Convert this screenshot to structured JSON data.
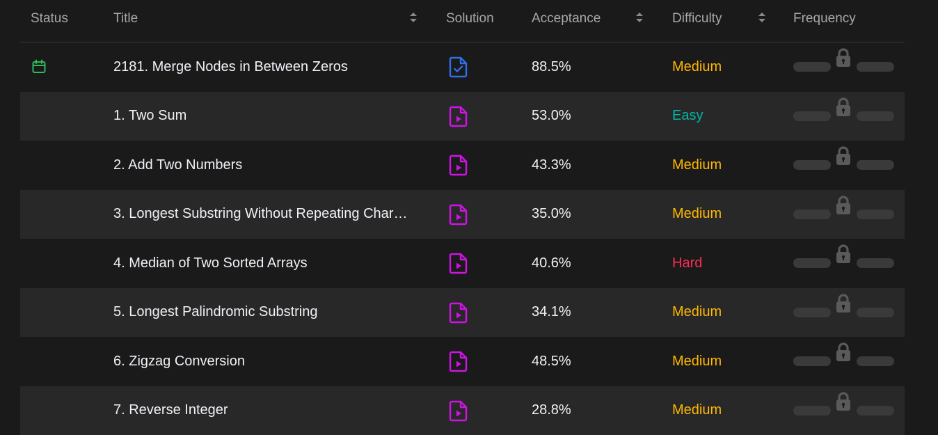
{
  "header": {
    "status": "Status",
    "title": "Title",
    "solution": "Solution",
    "acceptance": "Acceptance",
    "difficulty": "Difficulty",
    "frequency": "Frequency"
  },
  "colors": {
    "medium": "#ffb800",
    "easy": "#00b8a3",
    "hard": "#ff2d55",
    "daily_icon": "#2cbb5d",
    "solution_article": "#2f6fe8",
    "solution_video": "#d012e6"
  },
  "rows": [
    {
      "title": "2181. Merge Nodes in Between Zeros",
      "acceptance": "88.5%",
      "difficulty": "Medium",
      "status_icon": "calendar-icon",
      "solution_icon": "file-check-icon"
    },
    {
      "title": "1. Two Sum",
      "acceptance": "53.0%",
      "difficulty": "Easy",
      "solution_icon": "file-play-icon"
    },
    {
      "title": "2. Add Two Numbers",
      "acceptance": "43.3%",
      "difficulty": "Medium",
      "solution_icon": "file-play-icon"
    },
    {
      "title": "3. Longest Substring Without Repeating Char…",
      "acceptance": "35.0%",
      "difficulty": "Medium",
      "solution_icon": "file-play-icon"
    },
    {
      "title": "4. Median of Two Sorted Arrays",
      "acceptance": "40.6%",
      "difficulty": "Hard",
      "solution_icon": "file-play-icon"
    },
    {
      "title": "5. Longest Palindromic Substring",
      "acceptance": "34.1%",
      "difficulty": "Medium",
      "solution_icon": "file-play-icon"
    },
    {
      "title": "6. Zigzag Conversion",
      "acceptance": "48.5%",
      "difficulty": "Medium",
      "solution_icon": "file-play-icon"
    },
    {
      "title": "7. Reverse Integer",
      "acceptance": "28.8%",
      "difficulty": "Medium",
      "solution_icon": "file-play-icon"
    }
  ]
}
